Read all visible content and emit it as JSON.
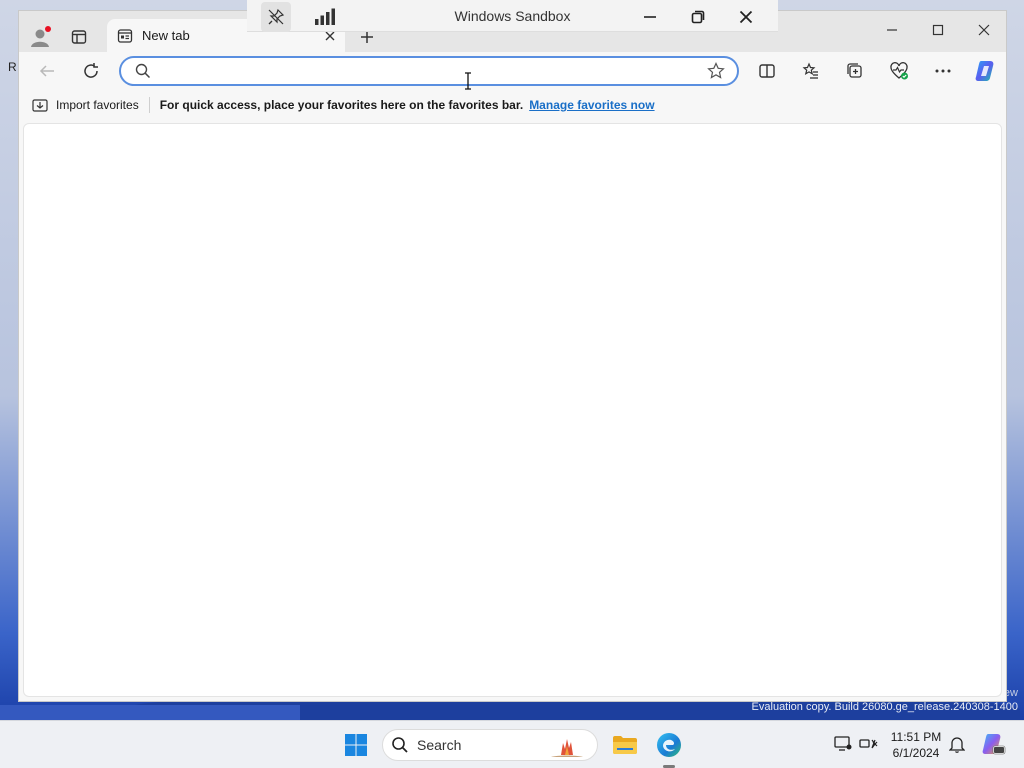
{
  "sandbox": {
    "title": "Windows Sandbox",
    "icons": [
      "unpin-icon",
      "signal-bars-icon",
      "minimize-icon",
      "restore-icon",
      "close-icon"
    ]
  },
  "browser": {
    "tab": {
      "title": "New tab"
    },
    "address_bar": {
      "value": "",
      "placeholder": ""
    },
    "favorites_bar": {
      "import_label": "Import favorites",
      "message": "For quick access, place your favorites here on the favorites bar.",
      "manage_link": "Manage favorites now"
    },
    "toolbar_icons": [
      "back-icon",
      "refresh-icon",
      "split-screen-icon",
      "favorites-icon",
      "collections-icon",
      "browser-essentials-icon",
      "more-icon",
      "copilot-icon"
    ]
  },
  "desktop": {
    "partial_label": "R",
    "watermark": "Evaluation copy. Build 26080.ge_release.240308-1400",
    "watermark_top": "iew"
  },
  "taskbar": {
    "search_label": "Search",
    "time": "11:51 PM",
    "date": "6/1/2024"
  },
  "colors": {
    "accent": "#0078d4",
    "link": "#1a6fc7",
    "address_border": "#5a8fe0"
  }
}
